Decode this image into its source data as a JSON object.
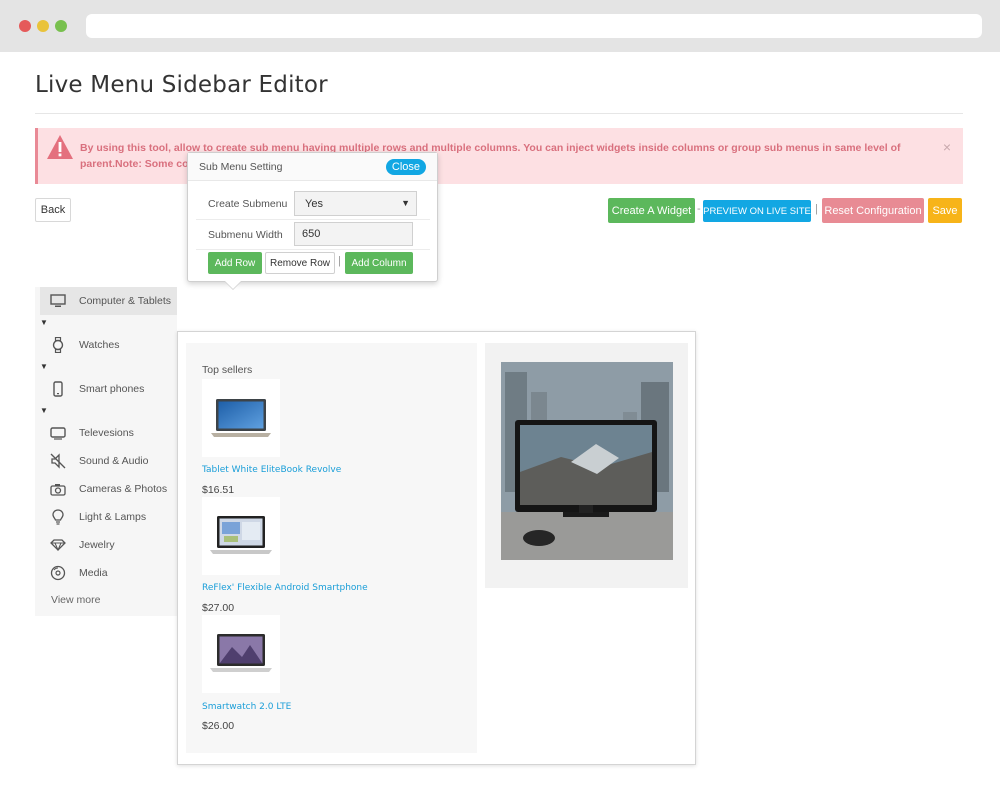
{
  "page": {
    "title": "Live Menu Sidebar Editor"
  },
  "alert": {
    "text": "By using this tool, allow to create sub menu having multiple rows and multiple columns. You can inject widgets inside columns or group sub menus in same level of parent.Note: Some configurations as",
    "close": "×"
  },
  "toolbar": {
    "back": "Back",
    "create_widget": "Create A Widget",
    "sep1": "-",
    "preview": "PREVIEW ON LIVE SITE",
    "sep2": "|",
    "reset": "Reset Configuration",
    "save": "Save"
  },
  "popup": {
    "title": "Sub Menu Setting",
    "close": "Close",
    "create_label": "Create Submenu",
    "create_value": "Yes",
    "width_label": "Submenu Width",
    "width_value": "650",
    "add_row": "Add Row",
    "remove_row": "Remove Row",
    "sep": "|",
    "add_column": "Add Column"
  },
  "sidebar": {
    "items": [
      {
        "label": "Computer & Tablets",
        "icon": "monitor-icon"
      },
      {
        "label": "Watches",
        "icon": "watch-icon"
      },
      {
        "label": "Smart phones",
        "icon": "phone-icon"
      },
      {
        "label": "Televesions",
        "icon": "tv-icon"
      },
      {
        "label": "Sound & Audio",
        "icon": "sound-icon"
      },
      {
        "label": "Cameras & Photos",
        "icon": "camera-icon"
      },
      {
        "label": "Light & Lamps",
        "icon": "lightbulb-icon"
      },
      {
        "label": "Jewelry",
        "icon": "diamond-icon"
      },
      {
        "label": "Media",
        "icon": "media-icon"
      }
    ],
    "caret": "▼",
    "more": "View more"
  },
  "mega": {
    "col1_title": "Top sellers",
    "products": [
      {
        "name": "Tablet White EliteBook Revolve",
        "price": "$16.51"
      },
      {
        "name": "ReFlex' Flexible Android Smartphone",
        "price": "$27.00"
      },
      {
        "name": "Smartwatch 2.0 LTE",
        "price": "$26.00"
      }
    ]
  }
}
